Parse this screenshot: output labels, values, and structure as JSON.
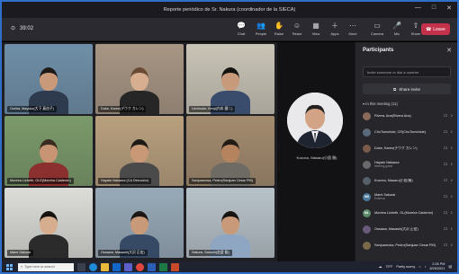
{
  "window": {
    "title": "Reporte periódico de Sr. Nakura (coordinador de la SIECA)",
    "controls": [
      "—",
      "□",
      "✕"
    ]
  },
  "toolbar": {
    "timer": "39:02",
    "buttons": [
      {
        "label": "Chat",
        "icon": "chat-icon",
        "glyph": "💬"
      },
      {
        "label": "People",
        "icon": "people-icon",
        "glyph": "👥"
      },
      {
        "label": "Raise",
        "icon": "raise-hand-icon",
        "glyph": "✋"
      },
      {
        "label": "React",
        "icon": "react-icon",
        "glyph": "☺"
      },
      {
        "label": "View",
        "icon": "view-icon",
        "glyph": "▦"
      },
      {
        "label": "Apps",
        "icon": "apps-icon",
        "glyph": "＋"
      },
      {
        "label": "More",
        "icon": "more-icon",
        "glyph": "⋯"
      },
      {
        "label": "Camera",
        "icon": "camera-icon",
        "glyph": "▭"
      },
      {
        "label": "Mic",
        "icon": "mic-icon",
        "glyph": "🎤"
      },
      {
        "label": "Share",
        "icon": "share-icon",
        "glyph": "⇧"
      }
    ],
    "leave_label": "Leave"
  },
  "grid": {
    "tiles": [
      {
        "name": "Oshita, Mayuko(大下 真由子)",
        "bg": "#6f8fa8",
        "skin": "#c99a7a",
        "hair": "#1d1a18",
        "shirt": "#2e3a4e"
      },
      {
        "name": "Duke, Karen(デウク カレン)",
        "bg": "#a89684",
        "skin": "#d7ae90",
        "hair": "#6b4a33",
        "shirt": "#262626"
      },
      {
        "name": "Uchimoto, Kenji(内本 健二)",
        "bg": "#c9c4b6",
        "skin": "#c89a7c",
        "hair": "#15130f",
        "shirt": "#3a4c6b"
      },
      {
        "name": "Moreira Lizbeth, GLE(Moreira Calderón)",
        "bg": "#7b9a6a",
        "skin": "#c79573",
        "hair": "#3a2b20",
        "shirt": "#8b2f2f"
      },
      {
        "name": "Hayato Nakaura (CA Dirección)",
        "bg": "#b9a07e",
        "skin": "#c99877",
        "hair": "#1e1b17",
        "shirt": "#4a4a4a"
      },
      {
        "name": "Sanjuanrosa, Pedro(Sanjuan Cesar PM)",
        "bg": "#a38b6e",
        "skin": "#b6835f",
        "hair": "#231b15",
        "shirt": "#6e6a64"
      },
      {
        "name": "Mami Sakurai",
        "bg": "#dcdcd8",
        "skin": "#d6ad8f",
        "hair": "#16120f",
        "shirt": "#2b2b2b"
      },
      {
        "name": "Ossawa, Masashi(大沢 正宏)",
        "bg": "#98aab8",
        "skin": "#c99a7a",
        "hair": "#1a1714",
        "shirt": "#364a66"
      },
      {
        "name": "Sakura, Satoshi(佐倉 聡)",
        "bg": "#b7c2c8",
        "skin": "#c99a7a",
        "hair": "#161311",
        "shirt": "#8fa6c2"
      }
    ]
  },
  "speaker": {
    "name": "Kozono, Masaru(小園 勝)"
  },
  "panel": {
    "title": "Participants",
    "invite_placeholder": "Invite someone or dial a number",
    "share_invite_label": "Share invite",
    "in_meeting_label": "In this meeting (11)",
    "participants": [
      {
        "name": "Rivera, Ana(Rivera Ana)",
        "sub": "",
        "initials": "",
        "color": "#8a6a5a"
      },
      {
        "name": "ChoTomohide, CR(ChoTomohide)",
        "sub": "",
        "initials": "",
        "color": "#5a6a7a"
      },
      {
        "name": "Duke, Karen(デウク カレン)",
        "sub": "",
        "initials": "",
        "color": "#7a5a4a"
      },
      {
        "name": "Hayato Nakaura",
        "sub": "Meeting guest",
        "initials": "",
        "color": "#6a6a6a"
      },
      {
        "name": "Kozono, Masaru(小園 勝)",
        "sub": "",
        "initials": "",
        "color": "#55606a"
      },
      {
        "name": "Mami Sakurai",
        "sub": "External",
        "initials": "MS",
        "color": "#4a7a9a"
      },
      {
        "name": "Moreira Lizbeth, GL(Moreira Calderón)",
        "sub": "",
        "initials": "ML",
        "color": "#5b8a6a"
      },
      {
        "name": "Ossawa, Masashi(大沢 正宏)",
        "sub": "",
        "initials": "",
        "color": "#6a5a7a"
      },
      {
        "name": "Sanjuanrosa, Pedro(Sanjuan Cesar PM)",
        "sub": "",
        "initials": "",
        "color": "#7a6a4a"
      }
    ]
  },
  "taskbar": {
    "search_placeholder": "Type here to search",
    "temperature": "79°F",
    "weather": "Partly sunny",
    "time": "2:28 PM",
    "date": "8/26/2021"
  }
}
